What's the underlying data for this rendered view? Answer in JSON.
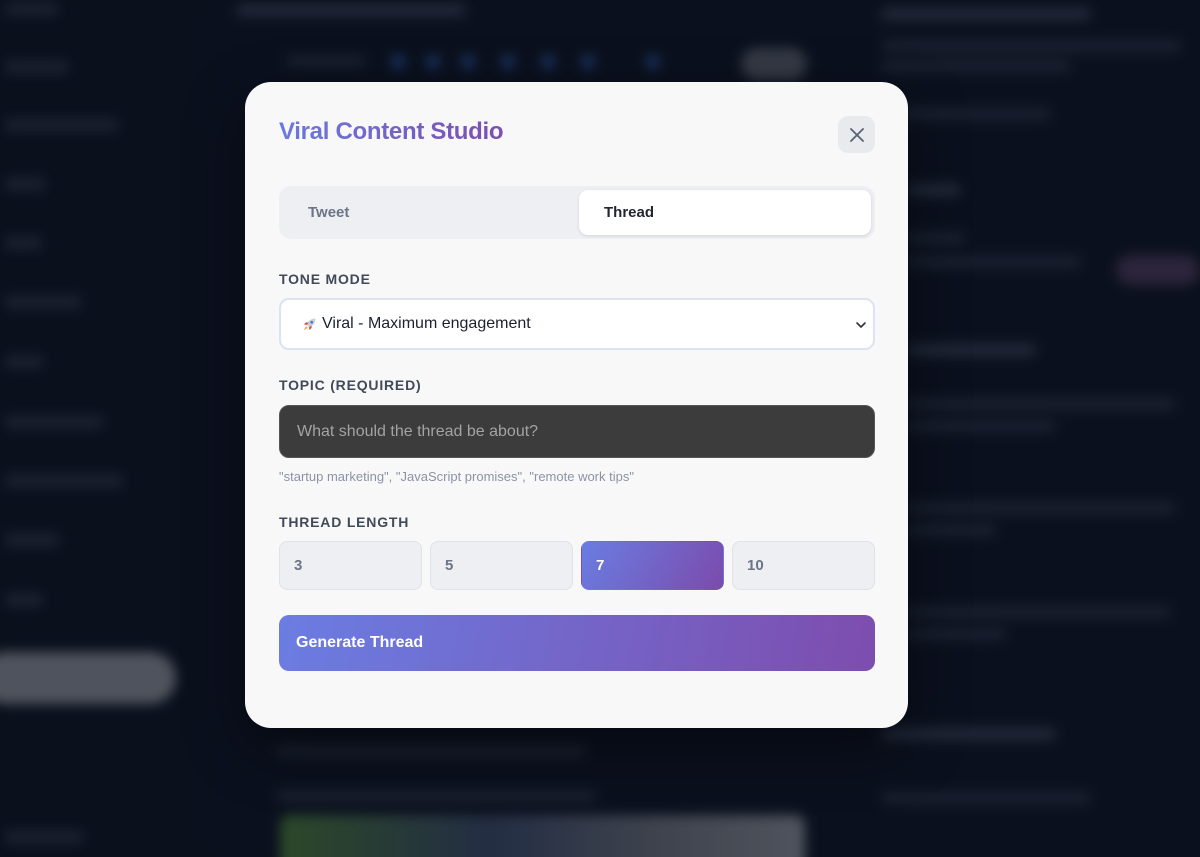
{
  "modal": {
    "title": "Viral Content Studio",
    "tabs": [
      {
        "label": "Tweet",
        "active": false
      },
      {
        "label": "Thread",
        "active": true
      }
    ],
    "tone": {
      "label": "TONE MODE",
      "emoji": "rocket",
      "selected": "Viral - Maximum engagement"
    },
    "topic": {
      "label": "TOPIC (REQUIRED)",
      "placeholder": "What should the thread be about?",
      "value": "",
      "hint": "\"startup marketing\", \"JavaScript promises\", \"remote work tips\""
    },
    "thread_length": {
      "label": "THREAD LENGTH",
      "options": [
        "3",
        "5",
        "7",
        "10"
      ],
      "selected": "7"
    },
    "generate_label": "Generate Thread"
  },
  "colors": {
    "accent_start": "#6b7de2",
    "accent_end": "#7d4dae",
    "modal_bg": "#f8f8f9",
    "backdrop": "#0d1422"
  },
  "icons": {
    "close": "close-icon",
    "chevron": "chevron-down-icon",
    "tone_emoji": "rocket-icon"
  }
}
